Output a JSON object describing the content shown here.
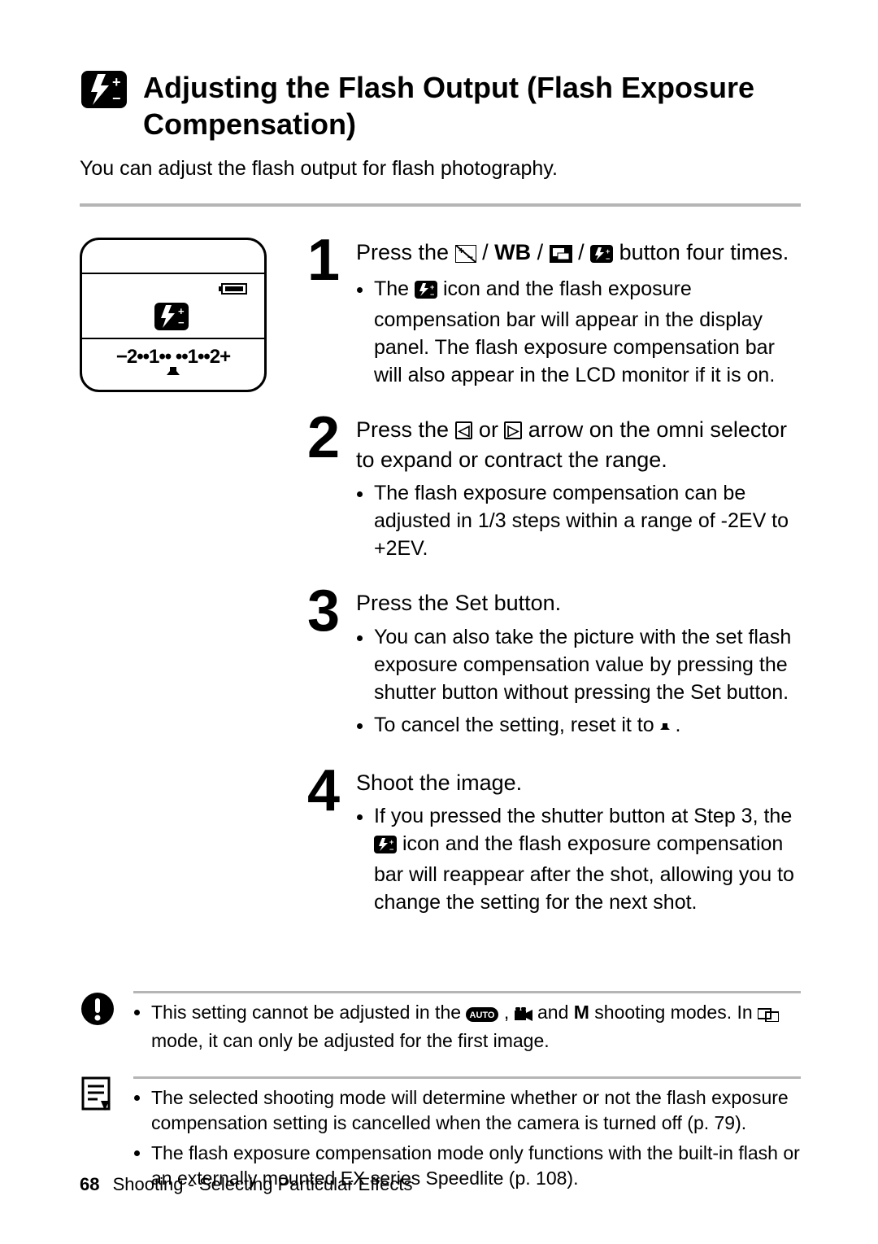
{
  "title": "Adjusting the Flash Output (Flash Exposure Compensation)",
  "intro": "You can adjust the flash output for flash photography.",
  "lcd": {
    "scale_text": "−2••1••  ••1••2+"
  },
  "steps": [
    {
      "num": "1",
      "head_parts": [
        "Press the ",
        " / ",
        "WB",
        " / ",
        " / ",
        " button four times."
      ],
      "head_wb": "WB",
      "bullets_a": "The ",
      "bullets_b": " icon and the flash exposure compensation bar will appear in the display panel. The flash exposure compensation bar will also appear in the LCD monitor if it is on."
    },
    {
      "num": "2",
      "head_a": "Press the ",
      "head_b": " or ",
      "head_c": " arrow on the omni selector to expand or contract the range.",
      "bullets": [
        "The flash exposure compensation can be adjusted in 1/3 steps within a range of -2EV to +2EV."
      ]
    },
    {
      "num": "3",
      "head": "Press the Set button.",
      "bullets_a": "You can also take the picture with the set flash exposure compensation value by pressing the shutter button without pressing the Set button.",
      "bullets_b1": "To cancel the setting, reset it to ",
      "bullets_b2": "."
    },
    {
      "num": "4",
      "head": "Shoot the image.",
      "bullets_a1": "If you pressed the shutter button at Step 3, the ",
      "bullets_a2": " icon and the flash exposure compensation bar will reappear after the shot, allowing you to change the setting for the next shot."
    }
  ],
  "note1_a": "This setting cannot be adjusted in the ",
  "note1_b": ", ",
  "note1_c": " and ",
  "note1_m": "M",
  "note1_d": " shooting modes. In ",
  "note1_e": " mode, it can only be adjusted for the first image.",
  "note2_a": "The selected shooting mode will determine whether or not the flash exposure compensation setting is cancelled when the camera is turned off (p. 79).",
  "note2_b": "The flash exposure compensation mode only functions with the built-in flash or an externally mounted EX series Speedlite (p. 108).",
  "footer": {
    "page": "68",
    "chapter": "Shooting - Selecting Particular Effects"
  }
}
